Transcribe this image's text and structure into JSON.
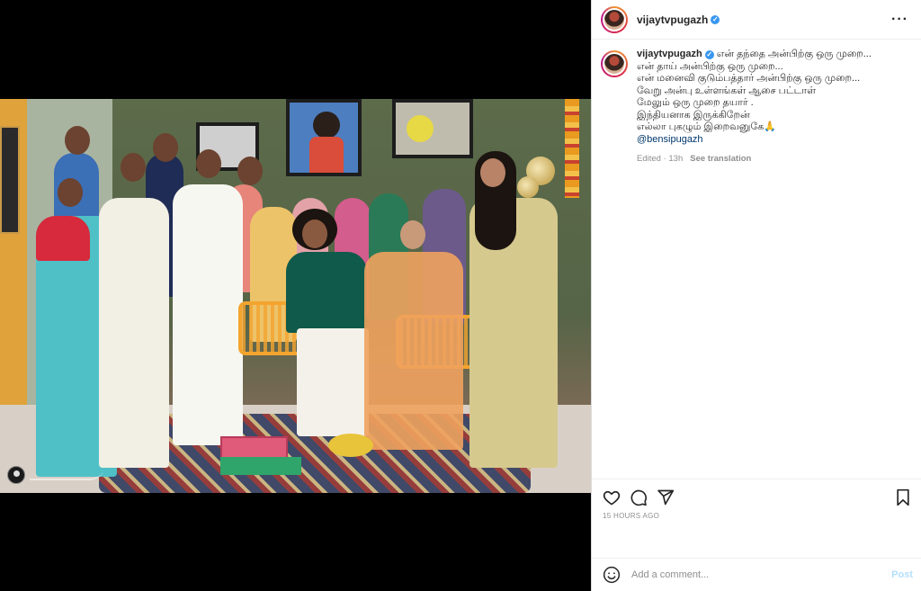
{
  "post": {
    "username": "vijaytvpugazh",
    "verified_icon": "✓",
    "more_options": "···"
  },
  "caption": {
    "username": "vijaytvpugazh",
    "lines": [
      "என் தந்தை அன்பிற்கு ஒரு முறை...",
      "என் தாய் அன்பிற்கு ஒரு முறை...",
      "என் மனைவி குடும்பத்தார் அன்பிற்கு ஒரு முறை...",
      "வேறு அன்பு உள்ளங்கள் ஆசை பட்டாள்",
      "மேலும் ஒரு முறை தயார் .",
      "இந்தியனாக இருக்கிறேன்",
      "எல்லா புகழும் இறைவனுகே🙏"
    ],
    "mention": "@bensipugazh",
    "edited": "Edited · 13h",
    "see_translation": "See translation"
  },
  "actions": {
    "icons": [
      "heart-icon",
      "comment-icon",
      "share-icon",
      "bookmark-icon"
    ],
    "timestamp": "15 HOURS AGO"
  },
  "comment_bar": {
    "emoji_icon": "smiley-icon",
    "placeholder": "Add a comment...",
    "post_label": "Post"
  },
  "colors": {
    "accent_disabled": "#b2dffc",
    "verified": "#3897f0",
    "mention": "#00376b",
    "muted": "#8e8e8e"
  },
  "media": {
    "watermark_icon": "camera-avatar-icon"
  }
}
